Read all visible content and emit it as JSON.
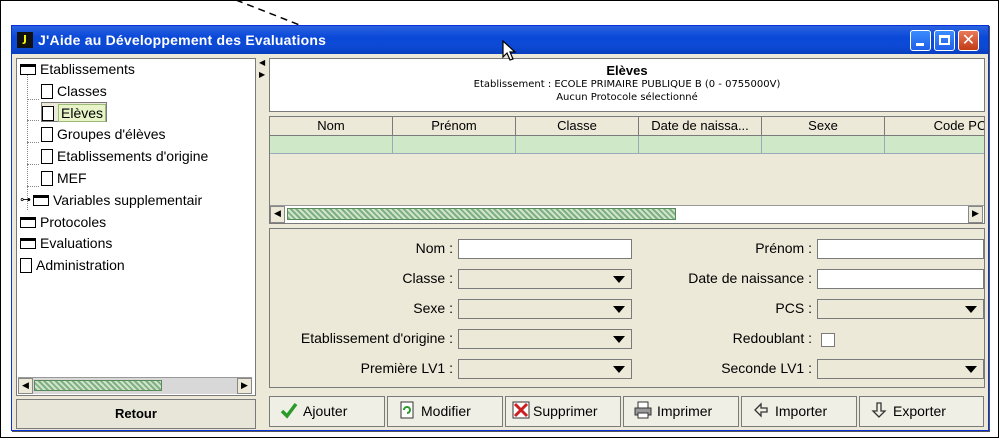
{
  "window": {
    "title": "J'Aide au Développement des Evaluations",
    "app_icon_letter": "J"
  },
  "sidebar": {
    "items": [
      {
        "label": "Etablissements",
        "icon": "folder-icon"
      },
      {
        "label": "Classes",
        "icon": "document-icon"
      },
      {
        "label": "Elèves",
        "icon": "document-icon",
        "selected": true
      },
      {
        "label": "Groupes d'élèves",
        "icon": "document-icon"
      },
      {
        "label": "Etablissements d'origine",
        "icon": "document-icon"
      },
      {
        "label": "MEF",
        "icon": "document-icon"
      },
      {
        "label": "Variables supplementair",
        "icon": "folder-icon",
        "expander": "key-icon"
      },
      {
        "label": "Protocoles",
        "icon": "folder-icon"
      },
      {
        "label": "Evaluations",
        "icon": "folder-icon"
      },
      {
        "label": "Administration",
        "icon": "document-icon"
      }
    ],
    "back_label": "Retour"
  },
  "header": {
    "title": "Elèves",
    "establishment": "Etablissement : ECOLE PRIMAIRE PUBLIQUE B (0 - 0755000V)",
    "protocol": "Aucun Protocole sélectionné"
  },
  "table": {
    "columns": [
      "Nom",
      "Prénom",
      "Classe",
      "Date de naissa...",
      "Sexe",
      "Code PCS"
    ]
  },
  "form": {
    "nom_label": "Nom :",
    "prenom_label": "Prénom :",
    "classe_label": "Classe :",
    "naissance_label": "Date de naissance :",
    "sexe_label": "Sexe :",
    "pcs_label": "PCS :",
    "origine_label": "Etablissement d'origine :",
    "redoublant_label": "Redoublant :",
    "lv1_label": "Première LV1 :",
    "lv2_label": "Seconde LV1 :"
  },
  "toolbar": {
    "add_label": "Ajouter",
    "edit_label": "Modifier",
    "delete_label": "Supprimer",
    "print_label": "Imprimer",
    "import_label": "Importer",
    "export_label": "Exporter"
  },
  "colors": {
    "title_bar": "#0a48d8",
    "selected_row": "#cfe8c8",
    "add_icon": "#2a9a2a",
    "delete_icon": "#cc1f1f"
  }
}
